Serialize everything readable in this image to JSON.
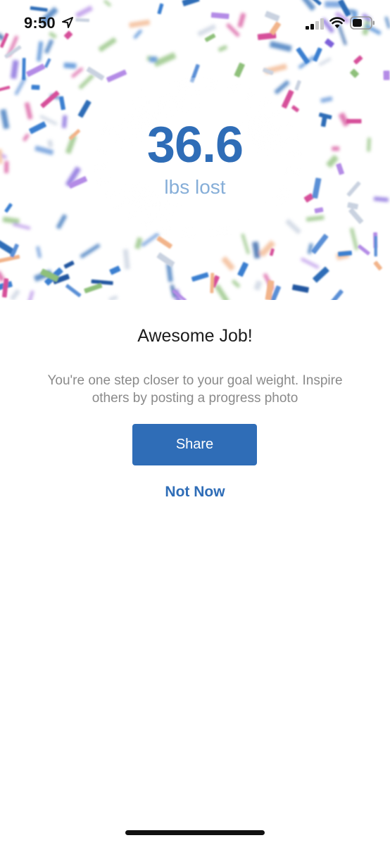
{
  "status_bar": {
    "time": "9:50",
    "location_icon": "location-arrow-icon",
    "signal_icon": "cellular-signal-icon",
    "wifi_icon": "wifi-icon",
    "battery_icon": "battery-icon"
  },
  "hero": {
    "value": "36.6",
    "label": "lbs lost",
    "decoration": "confetti"
  },
  "content": {
    "headline": "Awesome Job!",
    "message": "You're one step closer to your goal weight. Inspire others by posting a progress photo",
    "share_label": "Share",
    "not_now_label": "Not Now"
  },
  "colors": {
    "accent": "#2f6db7",
    "label_light_blue": "#86aed8",
    "body_text": "#8a8a8a",
    "headline_text": "#1c1c1c"
  }
}
